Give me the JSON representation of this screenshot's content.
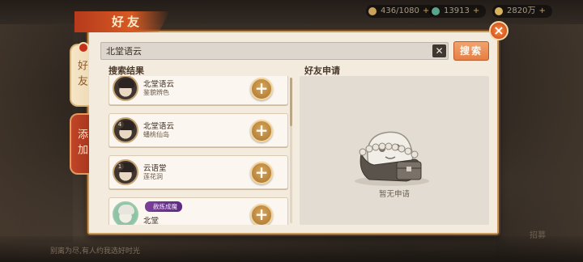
{
  "window": {
    "title": "好友"
  },
  "currency": [
    {
      "icon": "coin-icon",
      "value": "436/1080",
      "color": "#c9a35a"
    },
    {
      "icon": "jade-icon",
      "value": "13913",
      "color": "#5aa58a"
    },
    {
      "icon": "gold-icon",
      "value": "2820万",
      "color": "#d8b45c"
    }
  ],
  "tabs": [
    {
      "label": "好友",
      "active": false
    },
    {
      "label": "添加",
      "active": true
    }
  ],
  "search": {
    "value": "北堂语云",
    "button_label": "搜索",
    "clear_label": "✕"
  },
  "results": {
    "title": "搜索结果",
    "items": [
      {
        "name": "北堂语云",
        "sub": "鉴貌辨色",
        "level": "",
        "tag": "",
        "avatar": "dark"
      },
      {
        "name": "北堂语云",
        "sub": "蟠桃仙岛",
        "level": "4",
        "tag": "",
        "avatar": "dark"
      },
      {
        "name": "云语堂",
        "sub": "莲花洞",
        "level": "1",
        "tag": "",
        "avatar": "dark"
      },
      {
        "name": "北堂",
        "sub": "",
        "level": "",
        "tag": "赦炼成魔",
        "avatar": "green"
      }
    ]
  },
  "requests": {
    "title": "好友申请",
    "empty_text": "暂无申请"
  },
  "footer": {
    "text": "别离为尽,有人约我选好时光"
  },
  "side_right": {
    "items": [
      "招募"
    ]
  }
}
